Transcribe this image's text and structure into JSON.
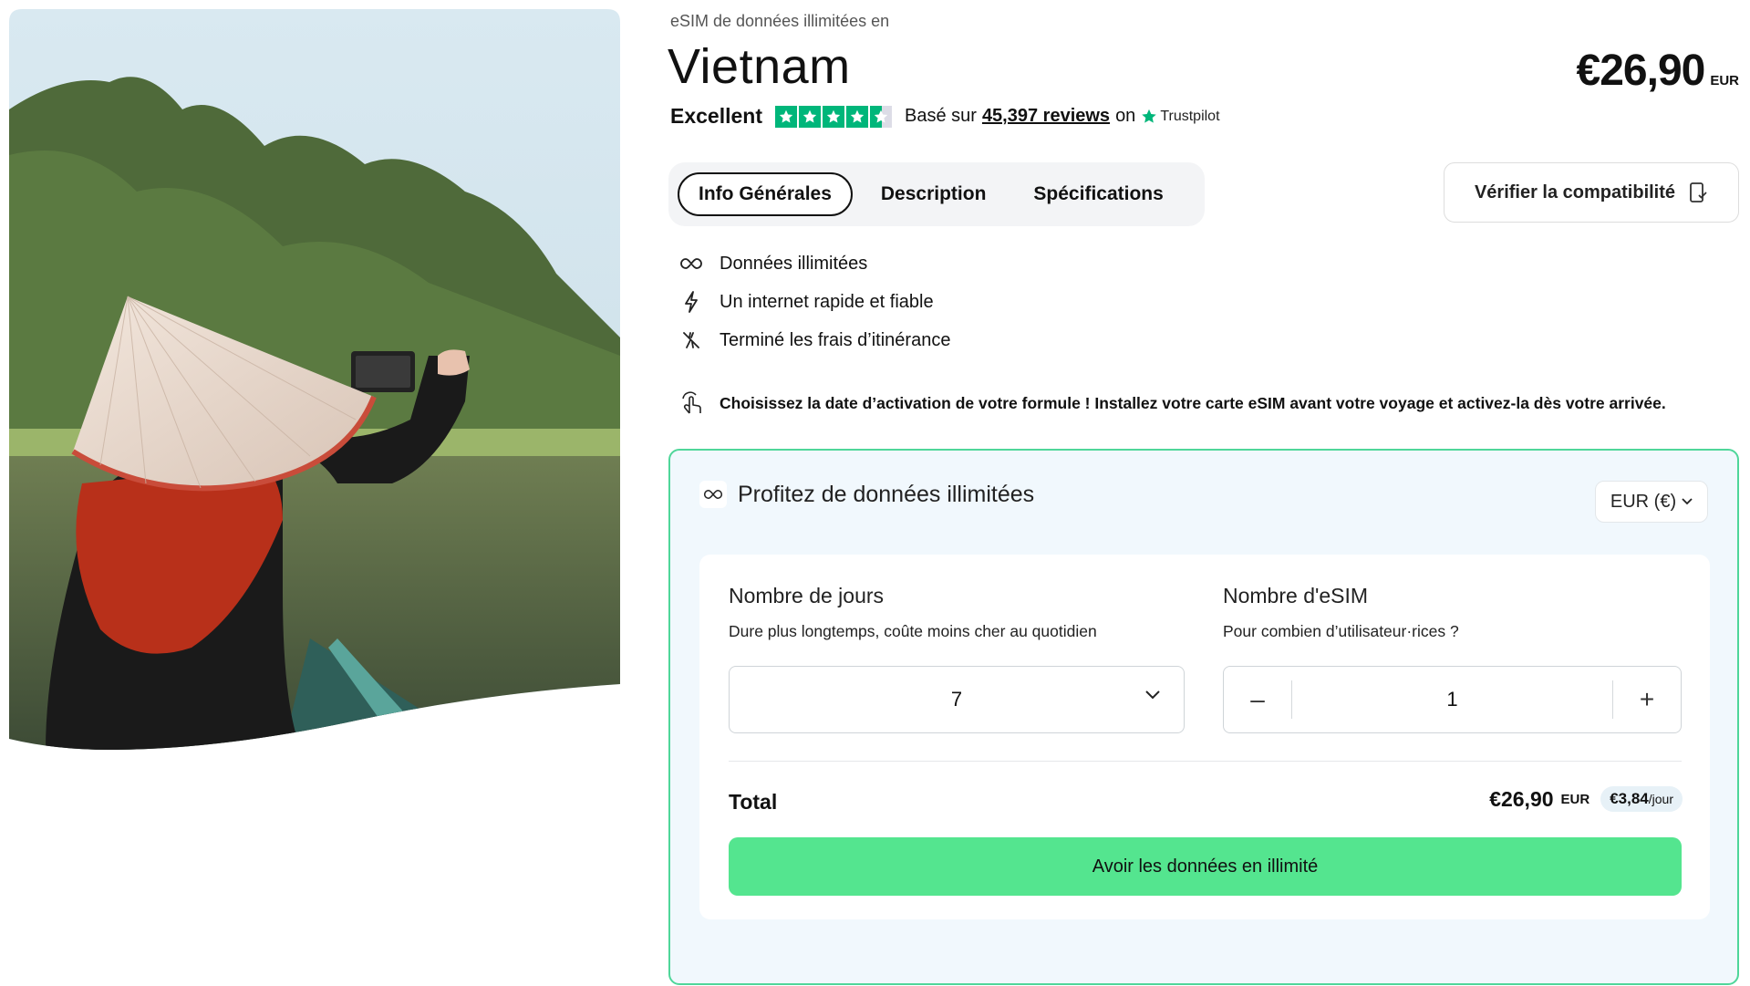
{
  "product": {
    "eyebrow": "eSIM de données illimitées en",
    "title": "Vietnam",
    "price": "€26,90",
    "price_currency": "EUR"
  },
  "rating": {
    "label": "Excellent",
    "stars": 4.5,
    "based_on": "Basé sur",
    "reviews_link": "45,397 reviews",
    "on": "on",
    "provider": "Trustpilot"
  },
  "tabs": [
    {
      "label": "Info Générales",
      "active": true
    },
    {
      "label": "Description",
      "active": false
    },
    {
      "label": "Spécifications",
      "active": false
    }
  ],
  "compat_button": {
    "label": "Vérifier la compatibilité",
    "icon": "phone-check-icon"
  },
  "features": [
    {
      "icon": "infinity-icon",
      "label": "Données illimitées"
    },
    {
      "icon": "lightning-icon",
      "label": "Un internet rapide et fiable"
    },
    {
      "icon": "no-roaming-icon",
      "label": "Terminé les frais d’itinérance"
    }
  ],
  "notice": {
    "icon": "tap-hand-icon",
    "text": "Choisissez la date d’activation de votre formule ! Installez votre carte eSIM avant votre voyage et activez-la dès votre arrivée."
  },
  "plan": {
    "heading": "Profitez de données illimitées",
    "currency": "EUR (€)",
    "days": {
      "title": "Nombre de jours",
      "subtitle": "Dure plus longtemps, coûte moins cher au quotidien",
      "value": "7"
    },
    "esims": {
      "title": "Nombre d'eSIM",
      "subtitle": "Pour combien d’utilisateur·rices ?",
      "value": "1",
      "minus": "–",
      "plus": "+"
    },
    "total": {
      "label": "Total",
      "amount": "€26,90",
      "currency": "EUR",
      "per_day_amount": "€3,84",
      "per_day_unit": "/jour"
    },
    "cta": "Avoir les données en illimité"
  },
  "colors": {
    "accent_green": "#54e58f",
    "panel_border": "#4fd69a",
    "panel_bg": "#f1f8fd",
    "trustpilot_green": "#00b67a"
  }
}
